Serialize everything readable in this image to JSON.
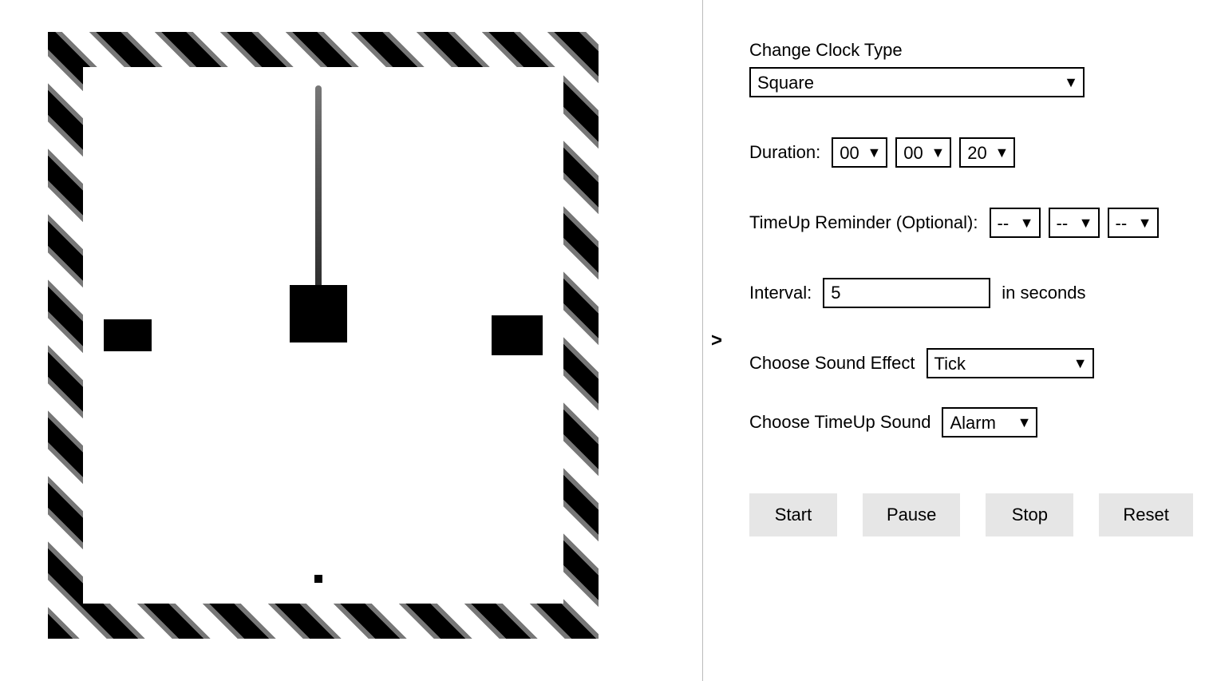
{
  "collapse_glyph": ">",
  "controls": {
    "clock_type": {
      "label": "Change Clock Type",
      "value": "Square"
    },
    "duration": {
      "label": "Duration:",
      "hours": "00",
      "minutes": "00",
      "seconds": "20"
    },
    "timeup_reminder": {
      "label": "TimeUp Reminder (Optional):",
      "hours": "--",
      "minutes": "--",
      "seconds": "--"
    },
    "interval": {
      "label": "Interval:",
      "value": "5",
      "suffix": "in seconds"
    },
    "sound_effect": {
      "label": "Choose Sound Effect",
      "value": "Tick"
    },
    "timeup_sound": {
      "label": "Choose TimeUp Sound",
      "value": "Alarm"
    }
  },
  "buttons": {
    "start": "Start",
    "pause": "Pause",
    "stop": "Stop",
    "reset": "Reset"
  }
}
